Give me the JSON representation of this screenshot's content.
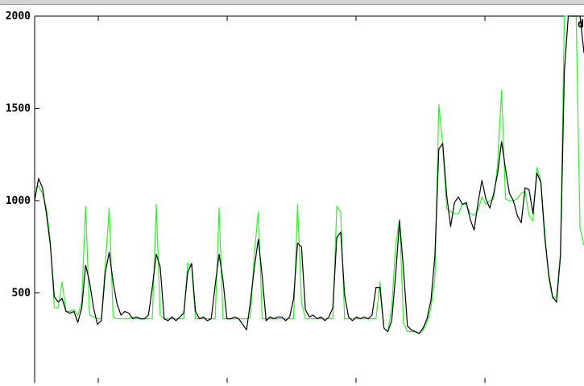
{
  "chart_data": {
    "type": "line",
    "title": "",
    "xlabel": "",
    "ylabel": "",
    "ylim": [
      0,
      2000
    ],
    "yticks": [
      500,
      1000,
      1500,
      2000
    ],
    "ytick_labels": [
      "500",
      "1000",
      "1500",
      "2000"
    ],
    "x_count": 200,
    "grid": false,
    "colors": {
      "black": "#000000",
      "green": "#33ee33"
    },
    "legend_fragment": "d",
    "series": [
      {
        "color": "#000000",
        "values": [
          1000,
          1120,
          1070,
          930,
          760,
          480,
          450,
          470,
          400,
          390,
          400,
          340,
          420,
          650,
          560,
          420,
          330,
          350,
          610,
          720,
          560,
          440,
          380,
          400,
          390,
          360,
          370,
          360,
          360,
          380,
          530,
          710,
          640,
          360,
          350,
          370,
          350,
          370,
          390,
          610,
          660,
          400,
          360,
          370,
          350,
          360,
          540,
          710,
          570,
          360,
          360,
          370,
          360,
          330,
          300,
          450,
          640,
          790,
          590,
          350,
          370,
          360,
          370,
          370,
          350,
          370,
          470,
          770,
          750,
          410,
          370,
          380,
          360,
          370,
          350,
          370,
          420,
          800,
          830,
          490,
          370,
          350,
          370,
          360,
          370,
          360,
          380,
          530,
          530,
          310,
          290,
          350,
          600,
          890,
          630,
          320,
          300,
          290,
          280,
          310,
          360,
          460,
          700,
          1280,
          1310,
          1030,
          860,
          990,
          1020,
          980,
          990,
          900,
          840,
          990,
          1110,
          1010,
          960,
          1040,
          1150,
          1320,
          1170,
          1040,
          1000,
          920,
          880,
          1070,
          1060,
          930,
          1150,
          1100,
          800,
          600,
          480,
          450,
          700,
          1700,
          2000,
          2000,
          2000,
          2000,
          1800
        ]
      },
      {
        "color": "#33ee33",
        "values": [
          1060,
          1080,
          1040,
          960,
          780,
          420,
          420,
          560,
          400,
          400,
          410,
          380,
          450,
          970,
          380,
          370,
          360,
          360,
          650,
          960,
          370,
          360,
          360,
          360,
          360,
          370,
          360,
          360,
          360,
          360,
          360,
          980,
          380,
          360,
          360,
          360,
          360,
          360,
          360,
          660,
          640,
          360,
          360,
          360,
          360,
          360,
          360,
          960,
          360,
          360,
          360,
          360,
          360,
          360,
          360,
          370,
          720,
          940,
          360,
          360,
          360,
          360,
          360,
          360,
          360,
          360,
          360,
          980,
          450,
          360,
          360,
          360,
          360,
          360,
          360,
          360,
          360,
          970,
          940,
          360,
          360,
          360,
          360,
          360,
          360,
          360,
          360,
          360,
          560,
          310,
          290,
          420,
          760,
          900,
          340,
          290,
          290,
          290,
          280,
          300,
          340,
          420,
          580,
          1520,
          1300,
          960,
          940,
          930,
          930,
          980,
          980,
          930,
          920,
          950,
          1020,
          980,
          1000,
          1010,
          1200,
          1600,
          1010,
          1000,
          1000,
          1010,
          1040,
          1050,
          920,
          890,
          1180,
          1110,
          830,
          580,
          470,
          480,
          720,
          2000,
          2000,
          2000,
          2000,
          850,
          760
        ]
      }
    ]
  }
}
